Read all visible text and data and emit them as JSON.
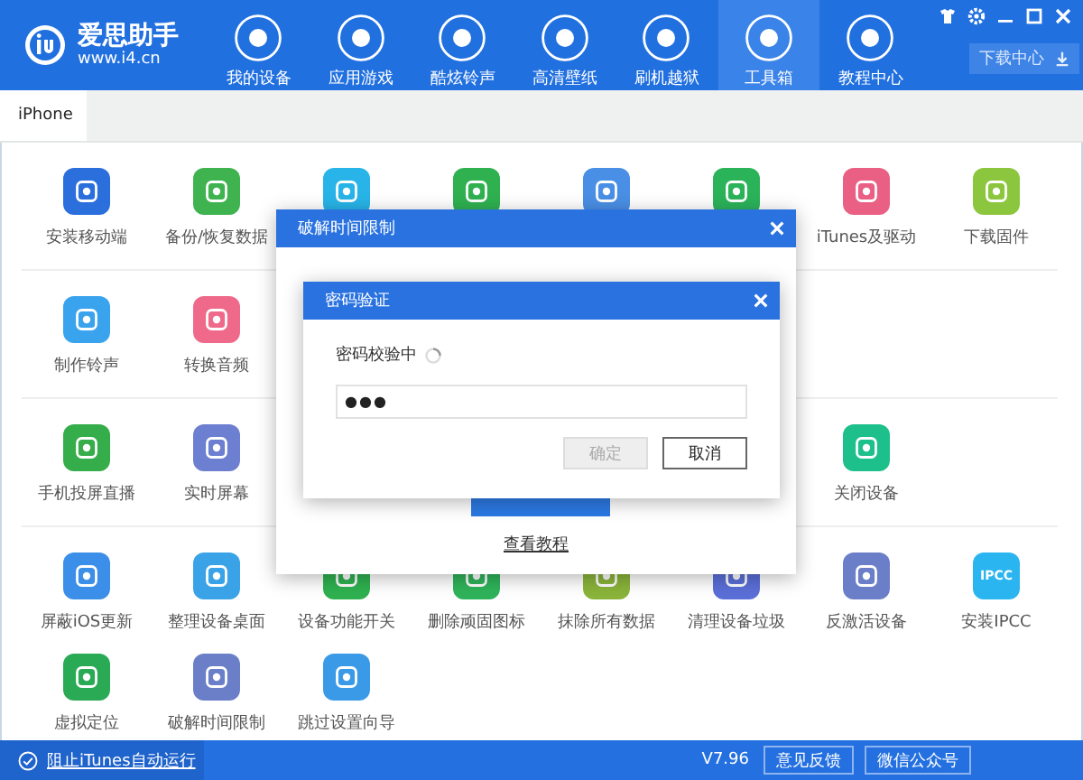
{
  "window": {
    "app_name": "爱思助手",
    "url": "www.i4.cn"
  },
  "nav": [
    {
      "label": "我的设备",
      "selected": false
    },
    {
      "label": "应用游戏",
      "selected": false
    },
    {
      "label": "酷炫铃声",
      "selected": false
    },
    {
      "label": "高清壁纸",
      "selected": false
    },
    {
      "label": "刷机越狱",
      "selected": false
    },
    {
      "label": "工具箱",
      "selected": true
    },
    {
      "label": "教程中心",
      "selected": false
    }
  ],
  "download_button": {
    "label": "下载中心"
  },
  "tabs": [
    {
      "label": "iPhone",
      "selected": true
    }
  ],
  "groups": [
    {
      "items": [
        {
          "kind": "tool",
          "label": "安装移动端",
          "color": "#2b6fdc"
        },
        {
          "kind": "tool",
          "label": "备份/恢复数据",
          "color": "#3fb34f"
        },
        {
          "kind": "tool",
          "color": "#28b4e8"
        },
        {
          "kind": "tool",
          "color": "#2fb150"
        },
        {
          "kind": "tool",
          "color": "#4a8fe6"
        },
        {
          "kind": "tool",
          "color": "#2bb35a"
        },
        {
          "kind": "tool",
          "label": "iTunes及驱动",
          "color": "#ea5f84"
        },
        {
          "kind": "tool",
          "label": "下载固件",
          "color": "#8cc63f"
        }
      ]
    },
    {
      "items": [
        {
          "kind": "tool",
          "label": "制作铃声",
          "color": "#3aa3ee"
        },
        {
          "kind": "tool",
          "label": "转换音频",
          "color": "#ef6a8a"
        }
      ]
    },
    {
      "items": [
        {
          "kind": "tool",
          "label": "手机投屏直播",
          "color": "#35ad4a"
        },
        {
          "kind": "tool",
          "label": "实时屏幕",
          "color": "#6c7fd0"
        },
        {
          "kind": "covered"
        },
        {
          "kind": "covered"
        },
        {
          "kind": "covered"
        },
        {
          "kind": "covered"
        },
        {
          "kind": "tool",
          "label": "关闭设备",
          "color": "#1dbf8a"
        }
      ]
    },
    {
      "items": [
        {
          "kind": "tool",
          "label": "屏蔽iOS更新",
          "color": "#3c8fe8"
        },
        {
          "kind": "tool",
          "label": "整理设备桌面",
          "color": "#3aa3e8"
        },
        {
          "kind": "tool",
          "label": "设备功能开关",
          "color": "#2fb150"
        },
        {
          "kind": "tool",
          "label": "删除顽固图标",
          "color": "#2fb35a"
        },
        {
          "kind": "tool",
          "label": "抹除所有数据",
          "color": "#8ab43a"
        },
        {
          "kind": "tool",
          "label": "清理设备垃圾",
          "color": "#5b6fd8"
        },
        {
          "kind": "tool",
          "label": "反激活设备",
          "color": "#6b7fc8"
        },
        {
          "kind": "tool",
          "label": "安装IPCC",
          "color": "#2bb5f0",
          "icon_text": "IPCC"
        },
        {
          "kind": "tool",
          "label": "虚拟定位",
          "color": "#2aaa55"
        },
        {
          "kind": "tool",
          "label": "破解时间限制",
          "color": "#6a7fc8"
        },
        {
          "kind": "tool",
          "label": "跳过设置向导",
          "color": "#3a9ae8"
        }
      ]
    }
  ],
  "dialog": {
    "title": "破解时间限制",
    "link": "查看教程"
  },
  "password_dialog": {
    "title": "密码验证",
    "status": "密码校验中",
    "value": "●●●",
    "buttons": [
      {
        "label": "确定",
        "disabled": true
      },
      {
        "label": "取消",
        "disabled": false
      }
    ]
  },
  "status_bar": {
    "itunes_block": "阻止iTunes自动运行",
    "version": "V7.96",
    "buttons": [
      "意见反馈",
      "微信公众号"
    ]
  }
}
